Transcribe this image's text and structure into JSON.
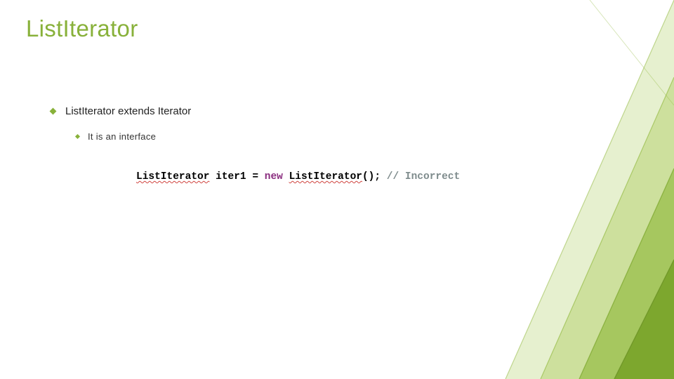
{
  "title": "ListIterator",
  "bullets": {
    "main": "ListIterator extends Iterator",
    "sub": "It is an interface"
  },
  "code": {
    "type1": "ListIterator",
    "var": "iter1",
    "eq": " = ",
    "kw_new": "new",
    "type2": "ListIterator",
    "paren": "();",
    "comment": "// Incorrect"
  },
  "colors": {
    "accent": "#88b13a",
    "keyword": "#8a2d7f",
    "comment": "#7f8c8d",
    "error_wave": "#d0443f"
  }
}
